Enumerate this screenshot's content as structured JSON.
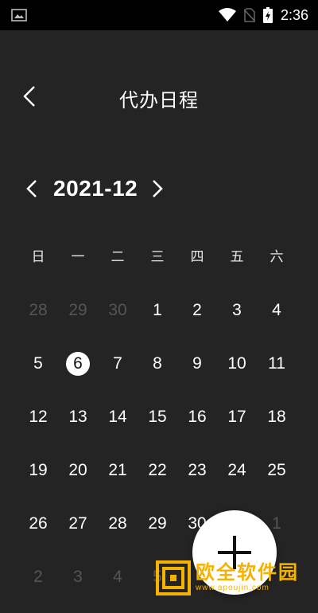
{
  "status_bar": {
    "time": "2:36"
  },
  "header": {
    "title": "代办日程"
  },
  "calendar": {
    "month_label": "2021-12",
    "weekdays": [
      "日",
      "一",
      "二",
      "三",
      "四",
      "五",
      "六"
    ],
    "weeks": [
      [
        "28",
        "29",
        "30",
        "1",
        "2",
        "3",
        "4"
      ],
      [
        "5",
        "6",
        "7",
        "8",
        "9",
        "10",
        "11"
      ],
      [
        "12",
        "13",
        "14",
        "15",
        "16",
        "17",
        "18"
      ],
      [
        "19",
        "20",
        "21",
        "22",
        "23",
        "24",
        "25"
      ],
      [
        "26",
        "27",
        "28",
        "29",
        "30",
        "",
        "1"
      ],
      [
        "2",
        "3",
        "4",
        "5",
        "",
        "",
        ""
      ]
    ],
    "muted_days": [
      [
        0,
        0
      ],
      [
        0,
        1
      ],
      [
        0,
        2
      ],
      [
        4,
        6
      ],
      [
        5,
        0
      ],
      [
        5,
        1
      ],
      [
        5,
        2
      ],
      [
        5,
        3
      ]
    ],
    "selected_day": "6",
    "colors": {
      "background": "#242424",
      "muted": "#555555",
      "accent": "#ffffff"
    }
  },
  "fab": {
    "icon": "plus-icon"
  },
  "watermark": {
    "text": "欧全软件园",
    "url": "www.apoujin.com"
  }
}
